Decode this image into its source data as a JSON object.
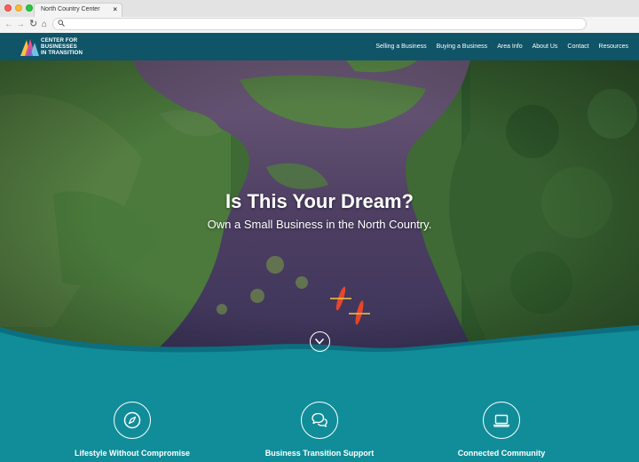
{
  "browser": {
    "tab_title": "North Country Center",
    "tab_close": "×",
    "nav_icons": [
      "back-icon",
      "forward-icon",
      "reload-icon",
      "home-icon",
      "search-icon"
    ]
  },
  "site": {
    "logo_lines": [
      "CENTER FOR",
      "BUSINESSES",
      "IN TRANSITION"
    ],
    "nav": [
      "Selling a Business",
      "Buying a Business",
      "Area Info",
      "About Us",
      "Contact",
      "Resources"
    ]
  },
  "hero": {
    "title": "Is This Your Dream?",
    "subtitle": "Own a Small Business in the North Country."
  },
  "features": [
    {
      "label": "Lifestyle Without Compromise",
      "icon": "compass-icon"
    },
    {
      "label": "Business Transition Support",
      "icon": "chat-bubbles-icon"
    },
    {
      "label": "Connected Community",
      "icon": "laptop-icon"
    }
  ],
  "colors": {
    "header_bg": "#0f5467",
    "band_bg": "#108d99",
    "accent_wave": "#0c6f80"
  }
}
